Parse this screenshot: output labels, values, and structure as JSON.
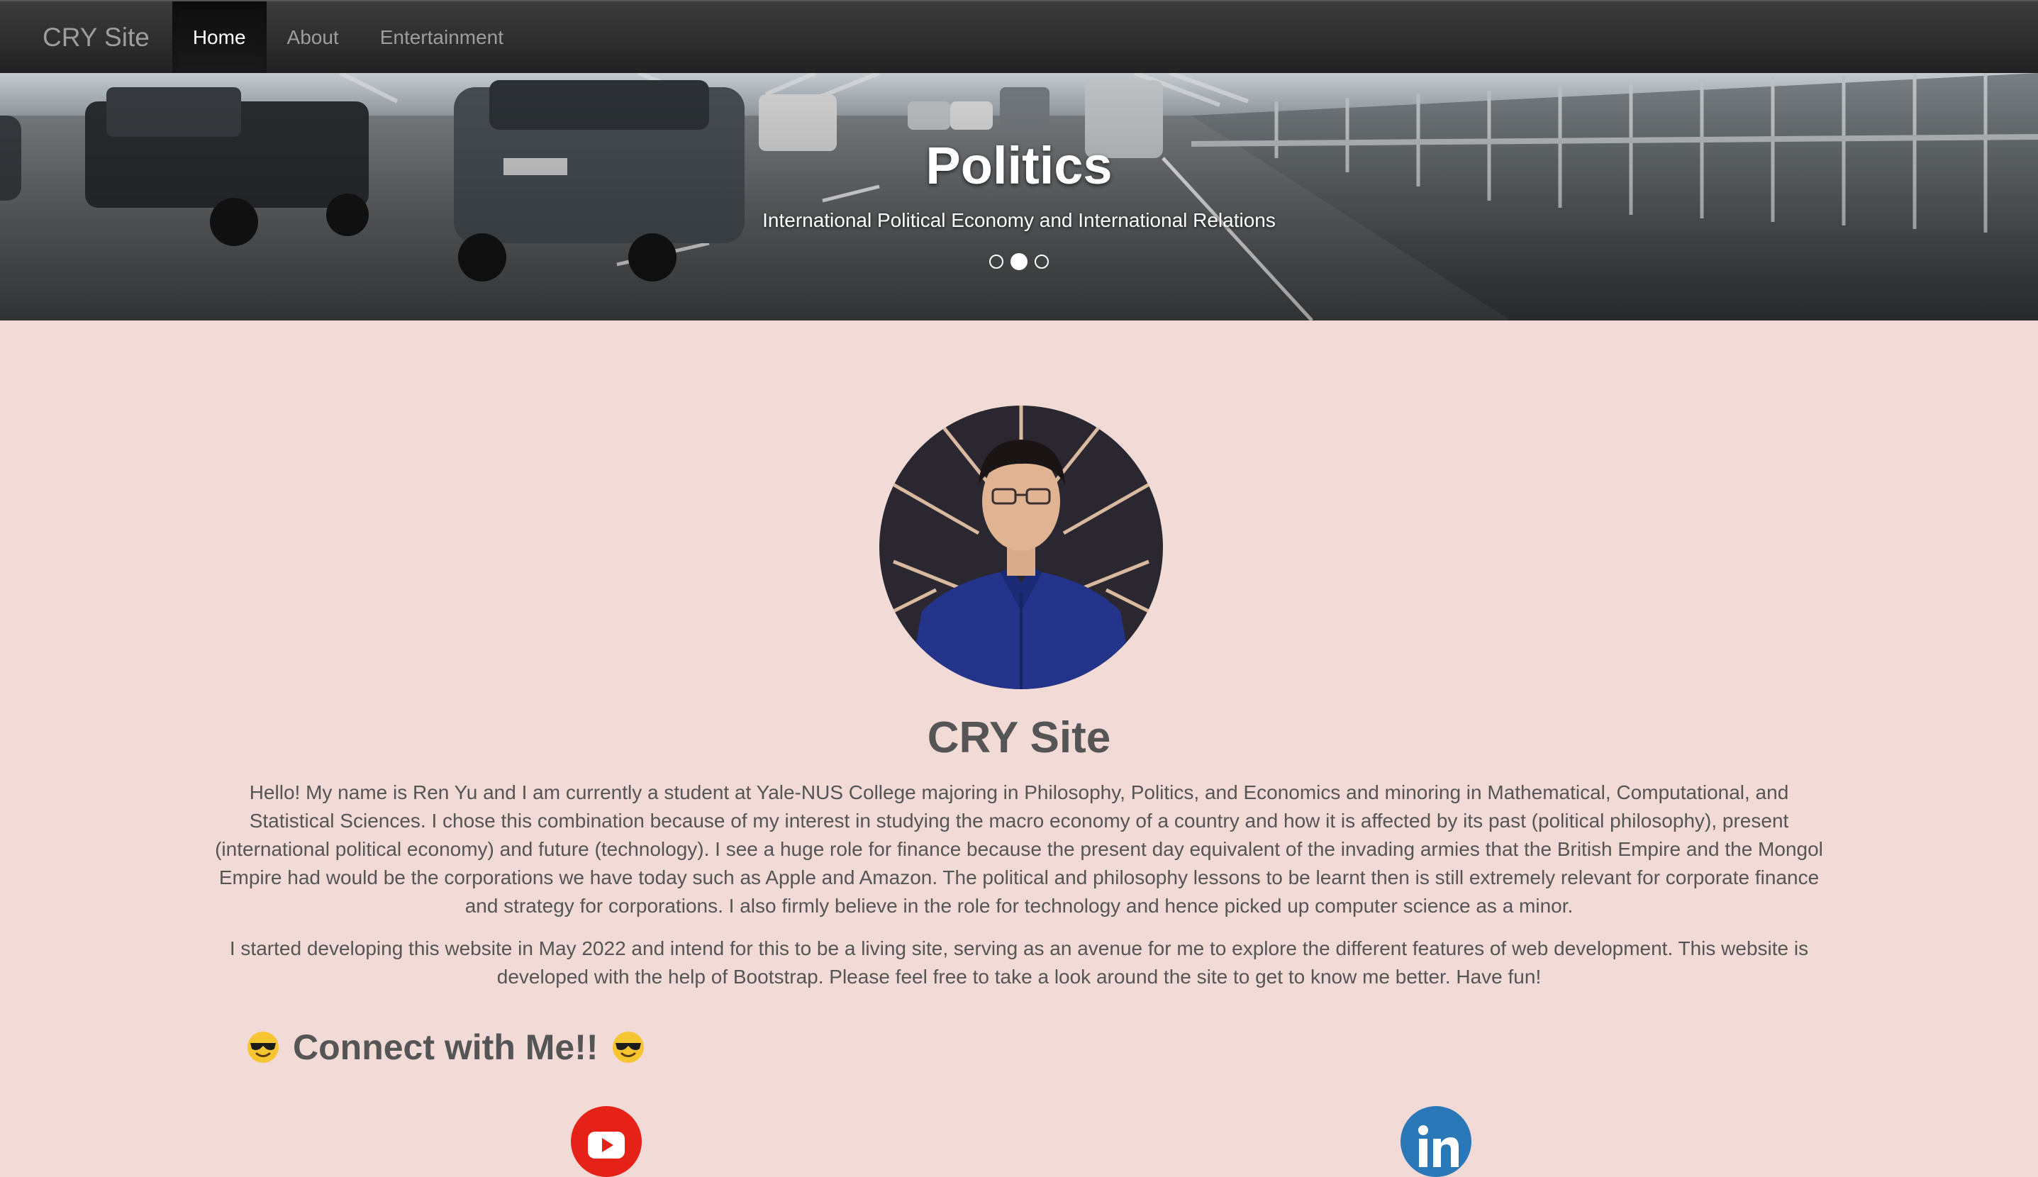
{
  "navbar": {
    "brand": "CRY Site",
    "items": [
      {
        "label": "Home",
        "active": true
      },
      {
        "label": "About",
        "active": false
      },
      {
        "label": "Entertainment",
        "active": false
      }
    ]
  },
  "carousel": {
    "title": "Politics",
    "subtitle": "International Political Economy and International Relations",
    "slide_count": 3,
    "active_index": 1
  },
  "profile": {
    "title": "CRY Site",
    "paragraph1": "Hello! My name is Ren Yu and I am currently a student at Yale-NUS College majoring in Philosophy, Politics, and Economics and minoring in Mathematical, Computational, and Statistical Sciences. I chose this combination because of my interest in studying the macro economy of a country and how it is affected by its past (political philosophy), present (international political economy) and future (technology). I see a huge role for finance because the present day equivalent of the invading armies that the British Empire and the Mongol Empire had would be the corporations we have today such as Apple and Amazon. The political and philosophy lessons to be learnt then is still extremely relevant for corporate finance and strategy for corporations. I also firmly believe in the role for technology and hence picked up computer science as a minor.",
    "paragraph2": "I started developing this website in May 2022 and intend for this to be a living site, serving as an avenue for me to explore the different features of web development. This website is developed with the help of Bootstrap. Please feel free to take a look around the site to get to know me better. Have fun!"
  },
  "connect": {
    "heading": "Connect with Me!!",
    "emoji_icon": "sunglasses-face-icon",
    "links": [
      {
        "icon": "youtube-icon",
        "color": "#e62117"
      },
      {
        "icon": "linkedin-icon",
        "color": "#2b78b8"
      }
    ]
  },
  "colors": {
    "page_background": "#f2dad7",
    "navbar": "#222222",
    "text": "#555555"
  }
}
